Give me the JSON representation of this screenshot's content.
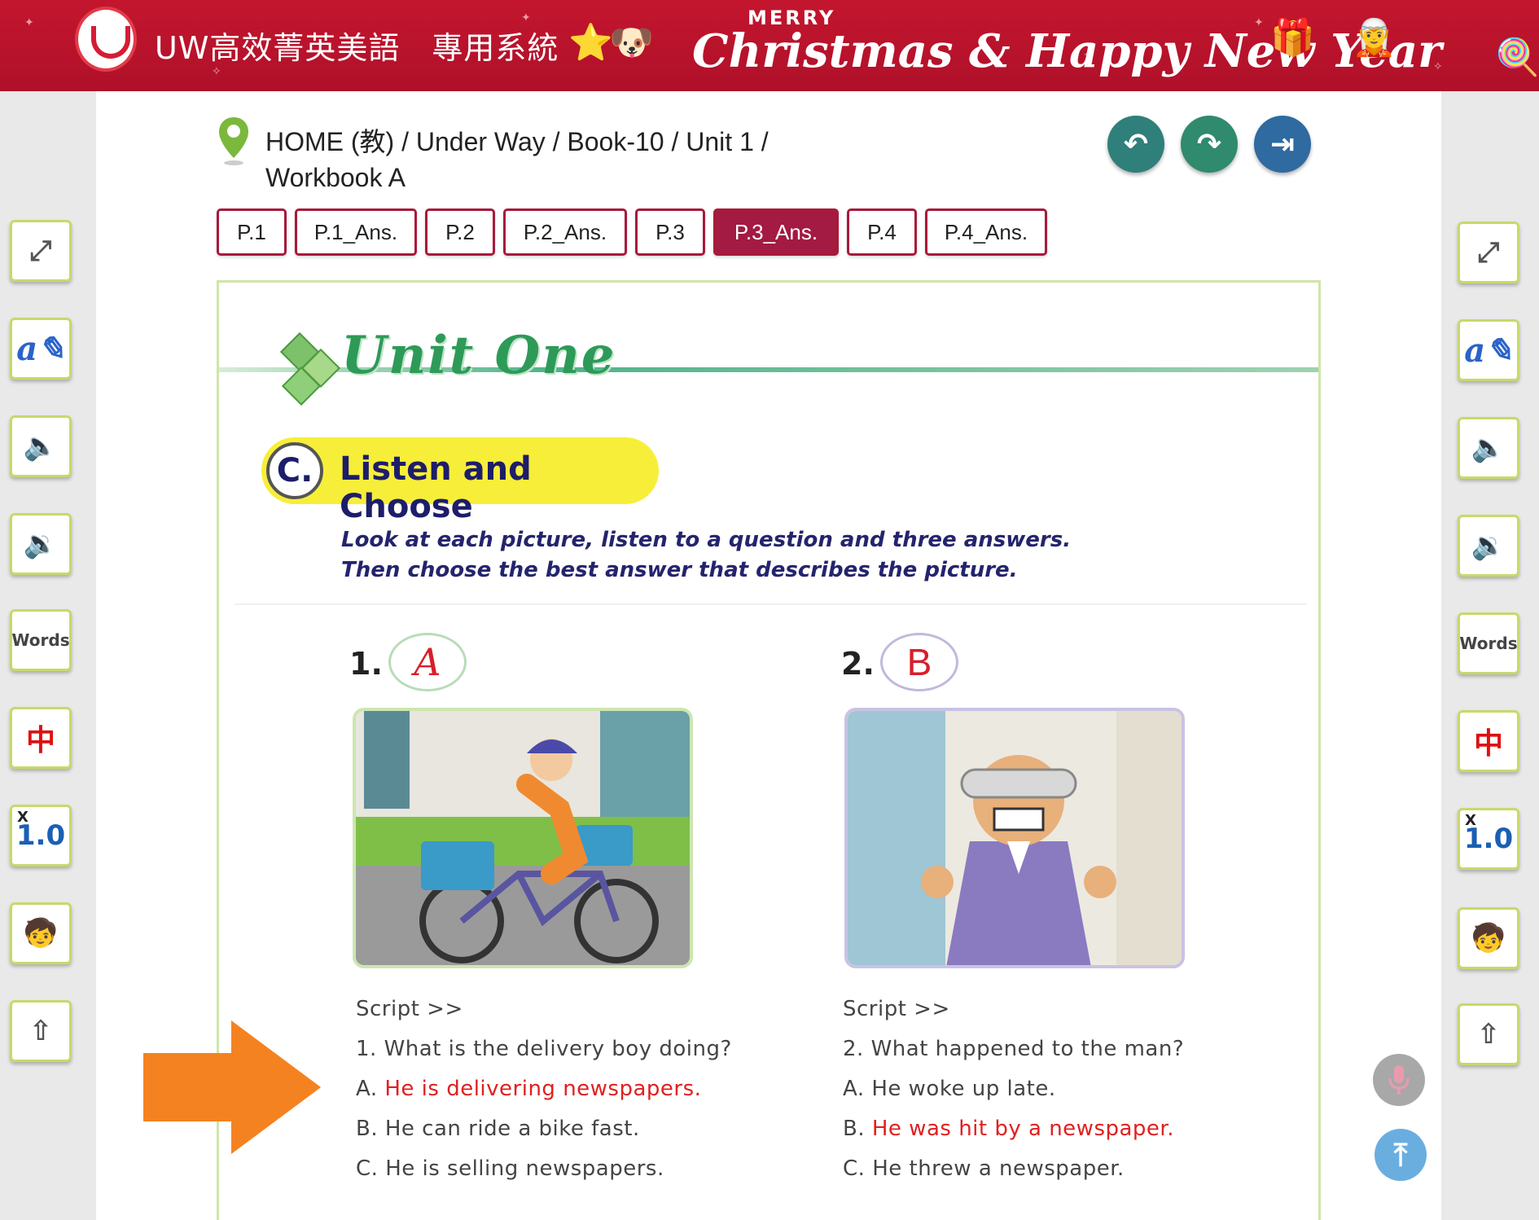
{
  "banner": {
    "site_title": "UW高效菁英美語　專用系統",
    "merry": "MERRY",
    "greeting": "Christmas & Happy New Year"
  },
  "breadcrumb": {
    "text": "HOME (教) / Under Way / Book-10 / Unit 1 / Workbook A"
  },
  "nav_buttons": {
    "back_icon": "undo-arrow-icon",
    "forward_icon": "redo-arrow-icon",
    "exit_icon": "logout-icon"
  },
  "tabs": [
    {
      "label": "P.1",
      "active": false
    },
    {
      "label": "P.1_Ans.",
      "active": false
    },
    {
      "label": "P.2",
      "active": false
    },
    {
      "label": "P.2_Ans.",
      "active": false
    },
    {
      "label": "P.3",
      "active": false
    },
    {
      "label": "P.3_Ans.",
      "active": true
    },
    {
      "label": "P.4",
      "active": false
    },
    {
      "label": "P.4_Ans.",
      "active": false
    }
  ],
  "sidebar_tools": {
    "words_label": "Words",
    "speed_label": "1.0",
    "speed_prefix": "X"
  },
  "workbook": {
    "unit_title": "Unit One",
    "section_letter": "C.",
    "section_title": "Listen and Choose",
    "instructions_line1": "Look at each picture, listen to a question and three answers.",
    "instructions_line2": "Then choose the best answer that describes the picture.",
    "questions": [
      {
        "number": "1.",
        "answer": "A",
        "script_label": "Script >>",
        "question": "1. What is the delivery boy doing?",
        "options": [
          {
            "letter": "A.",
            "text": "He is delivering newspapers.",
            "correct": true
          },
          {
            "letter": "B.",
            "text": "He can ride a bike fast.",
            "correct": false
          },
          {
            "letter": "C.",
            "text": "He is selling newspapers.",
            "correct": false
          }
        ]
      },
      {
        "number": "2.",
        "answer": "B",
        "script_label": "Script >>",
        "question": "2. What happened to the man?",
        "options": [
          {
            "letter": "A.",
            "text": "He woke up late.",
            "correct": false
          },
          {
            "letter": "B.",
            "text": "He was hit by a newspaper.",
            "correct": true
          },
          {
            "letter": "C.",
            "text": "He threw a newspaper.",
            "correct": false
          }
        ]
      }
    ]
  },
  "colors": {
    "banner_red": "#c3162e",
    "tab_active": "#a31a42",
    "correct_answer_red": "#e02020",
    "highlight_arrow": "#f58220"
  }
}
